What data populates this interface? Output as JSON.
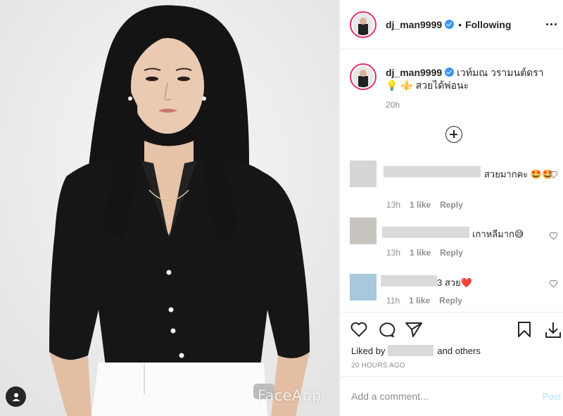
{
  "post": {
    "watermark": "FaceApp"
  },
  "header": {
    "username": "dj_man9999",
    "separator": "•",
    "follow_status": "Following"
  },
  "caption": {
    "username": "dj_man9999",
    "text": "เวท์มณ วรามนต์ดรา 💡 ⚜️ สวยได้พ่อนะ",
    "time": "20h"
  },
  "comments": [
    {
      "text": "สวยมากคะ 🤩🤩",
      "time": "13h",
      "likes": "1 like",
      "reply": "Reply",
      "avatar_color": "#d6d6d6"
    },
    {
      "text": "เกาหลีมาก😅",
      "time": "13h",
      "likes": "1 like",
      "reply": "Reply",
      "avatar_color": "#c8c4c0"
    },
    {
      "text": "3 สวย❤️",
      "time": "11h",
      "likes": "1 like",
      "reply": "Reply",
      "avatar_color": "#a8c8dc"
    }
  ],
  "actions": {
    "liked_by_prefix": "Liked by",
    "liked_by_suffix": "and others",
    "timestamp": "20 HOURS AGO"
  },
  "add_comment": {
    "placeholder": "Add a comment...",
    "post_label": "Post"
  },
  "icons": [
    "more-icon",
    "heart-icon",
    "comment-icon",
    "share-icon",
    "save-icon",
    "download-icon",
    "user-tag-icon",
    "add-circle-icon"
  ],
  "colors": {
    "accent": "#3897f0",
    "post_disabled": "#b2dffc",
    "story_ring": "#e1306c",
    "muted_text": "#8e8e8e"
  }
}
